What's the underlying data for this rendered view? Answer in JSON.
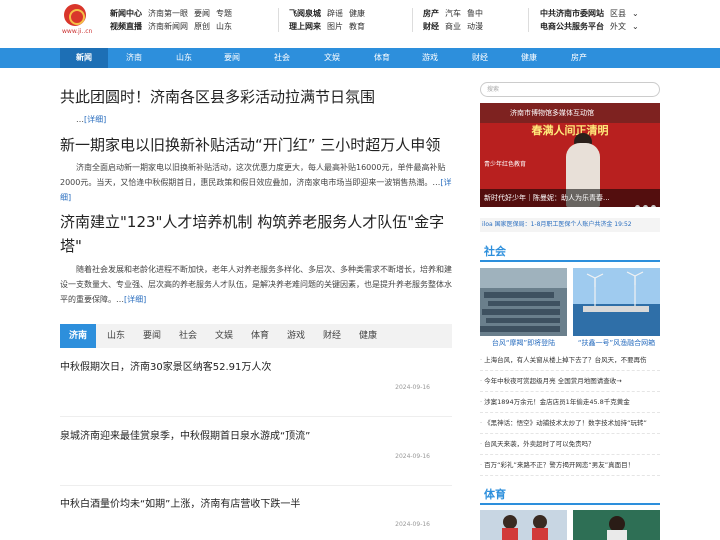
{
  "logo": {
    "sub": "www.ji..cn"
  },
  "topnav": {
    "col1": [
      [
        "新闻中心",
        "济南第一眼",
        "要闻",
        "专题"
      ],
      [
        "视频直播",
        "济南新闻网",
        "原创",
        "山东"
      ]
    ],
    "col2": [
      [
        "飞阅泉城",
        "辟谣",
        "健康"
      ],
      [
        "理上网来",
        "图片",
        "教育"
      ]
    ],
    "col3": [
      [
        "房产",
        "汽车",
        "鲁中"
      ],
      [
        "财经",
        "商业",
        "动漫"
      ]
    ],
    "col4": [
      [
        "中共济南市委网站",
        "区县"
      ],
      [
        "电商公共服务平台",
        "外文"
      ]
    ]
  },
  "navbar": [
    "新闻",
    "济南",
    "山东",
    "要闻",
    "社会",
    "文娱",
    "体育",
    "游戏",
    "财经",
    "健康",
    "房产"
  ],
  "headlines": [
    {
      "title": "共此团圆时！济南各区县多彩活动拉满节日氛围",
      "body": "…",
      "more": "[详细]"
    },
    {
      "title": "新一期家电以旧换新补贴活动“开门红” 三小时超万人申领",
      "body": "济南全面启动新一期家电以旧换新补贴活动，这次优惠力度更大，每人最高补贴16000元，单件最高补贴2000元。当天，又恰逢中秋假期首日，惠民政策和假日效应叠加，济南家电市场当即迎来一波销售热潮。…",
      "more": "[详细]"
    },
    {
      "title": "济南建立\"123\"人才培养机制 构筑养老服务人才队伍\"金字塔\"",
      "body": "随着社会发展和老龄化进程不断加快，老年人对养老服务多样化、多层次、多种类需求不断增长，培养和建设一支数量大、专业强、层次高的养老服务人才队伍，是解决养老难问题的关键因素，也是提升养老服务整体水平的重要保障。…",
      "more": "[详细]"
    }
  ],
  "tabs": [
    "济南",
    "山东",
    "要闻",
    "社会",
    "文娱",
    "体育",
    "游戏",
    "财经",
    "健康"
  ],
  "news": [
    {
      "title": "中秋假期次日，济南30家景区纳客52.91万人次",
      "date": "2024-09-16"
    },
    {
      "title": "泉城济南迎来最佳赏泉季，中秋假期首日泉水游成“顶流”",
      "date": "2024-09-16"
    },
    {
      "title": "中秋白酒量价均未“如期”上涨，济南有店营收下跌一半",
      "date": "2024-09-16"
    }
  ],
  "side": {
    "search_placeholder": "搜索",
    "banner": {
      "roof": "济南市博物馆多媒体互动馆",
      "line1": "春满人间正清明",
      "line2": "青少年红色教育",
      "caption": "新时代好少年｜陈曼妮：助人为乐青春..."
    },
    "ticker": "iloa 国家医保局：1-8月职工医保个人账户共济金 19:52",
    "section1": "社会",
    "thumbs": [
      {
        "cap": "台风“摩羯”即将登陆"
      },
      {
        "cap": "“扶鑫一号”风渔融合网箱"
      }
    ],
    "list": [
      "上海台风，有人关窗从楼上掉下去了？台风天，不要再伤",
      "今年中秋夜可赏超级月亮 全国赏月地图请查收→",
      "涉案1894万余元！金店店员1年偷走45.8千克黄金",
      "《黑神话：悟空》动捕技术太炒了！数字技术加持“玩转”",
      "台风天来袭，外卖超时了可以免责吗？",
      "百万“彩礼”来路不正？警方揭开网恋“男友”真面目！"
    ],
    "section2": "体育"
  },
  "colors": {
    "blue": "#2d8fdc",
    "link": "#2a6ebf"
  }
}
